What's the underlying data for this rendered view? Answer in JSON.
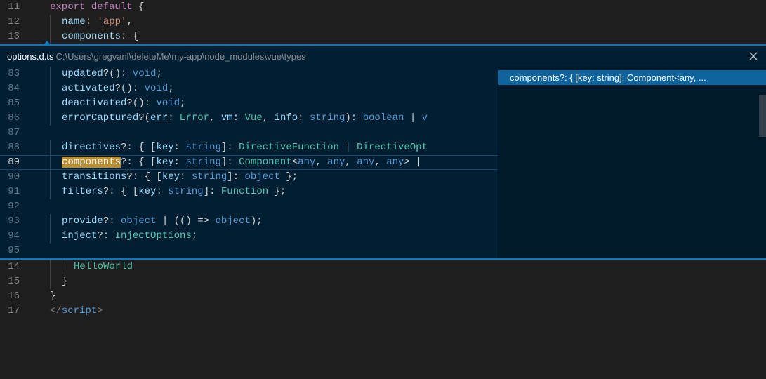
{
  "top": {
    "lines": [
      {
        "n": "11",
        "ind": 0,
        "seg": [
          [
            "kw",
            "export"
          ],
          [
            "punc",
            " "
          ],
          [
            "kw",
            "default"
          ],
          [
            "punc",
            " {"
          ]
        ]
      },
      {
        "n": "12",
        "ind": 1,
        "seg": [
          [
            "key",
            "name"
          ],
          [
            "punc",
            ": "
          ],
          [
            "str",
            "'app'"
          ],
          [
            "punc",
            ","
          ]
        ]
      },
      {
        "n": "13",
        "ind": 1,
        "seg": [
          [
            "key",
            "components"
          ],
          [
            "punc",
            ": {"
          ]
        ]
      }
    ]
  },
  "peek": {
    "file": "options.d.ts",
    "path": "C:\\Users\\gregvanl\\deleteMe\\my-app\\node_modules\\vue\\types",
    "reference": "components?: { [key: string]: Component<any, ...",
    "lines": [
      {
        "n": "83",
        "ind": 1,
        "seg": [
          [
            "key",
            "updated"
          ],
          [
            "punc",
            "?(): "
          ],
          [
            "prim",
            "void"
          ],
          [
            "punc",
            ";"
          ]
        ]
      },
      {
        "n": "84",
        "ind": 1,
        "seg": [
          [
            "key",
            "activated"
          ],
          [
            "punc",
            "?(): "
          ],
          [
            "prim",
            "void"
          ],
          [
            "punc",
            ";"
          ]
        ]
      },
      {
        "n": "85",
        "ind": 1,
        "seg": [
          [
            "key",
            "deactivated"
          ],
          [
            "punc",
            "?(): "
          ],
          [
            "prim",
            "void"
          ],
          [
            "punc",
            ";"
          ]
        ]
      },
      {
        "n": "86",
        "ind": 1,
        "seg": [
          [
            "key",
            "errorCaptured"
          ],
          [
            "punc",
            "?("
          ],
          [
            "key",
            "err"
          ],
          [
            "punc",
            ": "
          ],
          [
            "type",
            "Error"
          ],
          [
            "punc",
            ", "
          ],
          [
            "key",
            "vm"
          ],
          [
            "punc",
            ": "
          ],
          [
            "type",
            "Vue"
          ],
          [
            "punc",
            ", "
          ],
          [
            "key",
            "info"
          ],
          [
            "punc",
            ": "
          ],
          [
            "prim",
            "string"
          ],
          [
            "punc",
            "): "
          ],
          [
            "prim",
            "boolean"
          ],
          [
            "punc",
            " | "
          ],
          [
            "prim",
            "v"
          ]
        ]
      },
      {
        "n": "87",
        "ind": 1,
        "seg": []
      },
      {
        "n": "88",
        "ind": 1,
        "seg": [
          [
            "key",
            "directives"
          ],
          [
            "punc",
            "?: { ["
          ],
          [
            "key",
            "key"
          ],
          [
            "punc",
            ": "
          ],
          [
            "prim",
            "string"
          ],
          [
            "punc",
            "]: "
          ],
          [
            "type",
            "DirectiveFunction"
          ],
          [
            "punc",
            " | "
          ],
          [
            "type",
            "DirectiveOpt"
          ]
        ]
      },
      {
        "n": "89",
        "ind": 1,
        "cur": true,
        "seg": [
          [
            "hl",
            "components"
          ],
          [
            "punc",
            "?: { ["
          ],
          [
            "key",
            "key"
          ],
          [
            "punc",
            ": "
          ],
          [
            "prim",
            "string"
          ],
          [
            "punc",
            "]: "
          ],
          [
            "type",
            "Component"
          ],
          [
            "punc",
            "<"
          ],
          [
            "prim",
            "any"
          ],
          [
            "punc",
            ", "
          ],
          [
            "prim",
            "any"
          ],
          [
            "punc",
            ", "
          ],
          [
            "prim",
            "any"
          ],
          [
            "punc",
            ", "
          ],
          [
            "prim",
            "any"
          ],
          [
            "punc",
            "> |"
          ]
        ]
      },
      {
        "n": "90",
        "ind": 1,
        "seg": [
          [
            "key",
            "transitions"
          ],
          [
            "punc",
            "?: { ["
          ],
          [
            "key",
            "key"
          ],
          [
            "punc",
            ": "
          ],
          [
            "prim",
            "string"
          ],
          [
            "punc",
            "]: "
          ],
          [
            "prim",
            "object"
          ],
          [
            "punc",
            " };"
          ]
        ]
      },
      {
        "n": "91",
        "ind": 1,
        "seg": [
          [
            "key",
            "filters"
          ],
          [
            "punc",
            "?: { ["
          ],
          [
            "key",
            "key"
          ],
          [
            "punc",
            ": "
          ],
          [
            "prim",
            "string"
          ],
          [
            "punc",
            "]: "
          ],
          [
            "type",
            "Function"
          ],
          [
            "punc",
            " };"
          ]
        ]
      },
      {
        "n": "92",
        "ind": 1,
        "seg": []
      },
      {
        "n": "93",
        "ind": 1,
        "seg": [
          [
            "key",
            "provide"
          ],
          [
            "punc",
            "?: "
          ],
          [
            "prim",
            "object"
          ],
          [
            "punc",
            " | (() => "
          ],
          [
            "prim",
            "object"
          ],
          [
            "punc",
            ");"
          ]
        ]
      },
      {
        "n": "94",
        "ind": 1,
        "seg": [
          [
            "key",
            "inject"
          ],
          [
            "punc",
            "?: "
          ],
          [
            "type",
            "InjectOptions"
          ],
          [
            "punc",
            ";"
          ]
        ]
      },
      {
        "n": "95",
        "ind": 1,
        "seg": []
      }
    ]
  },
  "bottom": {
    "lines": [
      {
        "n": "14",
        "ind": 2,
        "seg": [
          [
            "type",
            "HelloWorld"
          ]
        ]
      },
      {
        "n": "15",
        "ind": 1,
        "seg": [
          [
            "punc",
            "}"
          ]
        ]
      },
      {
        "n": "16",
        "ind": 0,
        "seg": [
          [
            "punc",
            "}"
          ]
        ]
      },
      {
        "n": "17",
        "ind": 0,
        "tag": true
      }
    ]
  }
}
